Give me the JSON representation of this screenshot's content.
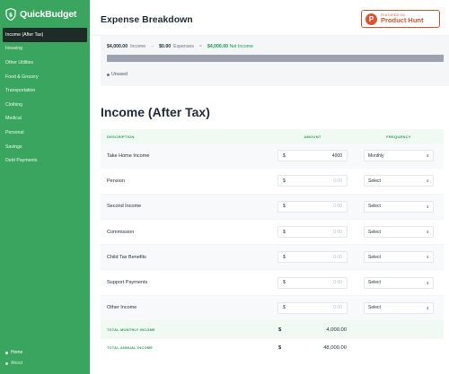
{
  "app": {
    "name": "QuickBudget"
  },
  "sidebar": {
    "items": [
      {
        "label": "Income (After Tax)",
        "active": true
      },
      {
        "label": "Housing"
      },
      {
        "label": "Other Utilities"
      },
      {
        "label": "Food & Grocery"
      },
      {
        "label": "Transportation"
      },
      {
        "label": "Clothing"
      },
      {
        "label": "Medical"
      },
      {
        "label": "Personal"
      },
      {
        "label": "Savings"
      },
      {
        "label": "Debt Payments"
      }
    ],
    "footer": [
      {
        "label": "Home"
      },
      {
        "label": "About"
      }
    ]
  },
  "header": {
    "title": "Expense Breakdown",
    "producthunt": {
      "small": "FEATURED ON",
      "big": "Product Hunt",
      "icon_letter": "P"
    }
  },
  "summary": {
    "income_value": "$4,000.00",
    "income_label": "Income",
    "op1": "−",
    "expenses_value": "$0.00",
    "expenses_label": "Expenses",
    "op2": "=",
    "net_value": "$4,000.00",
    "net_label": "Net Income",
    "legend_unused": "Unused",
    "bar_color": "#9ca3af"
  },
  "income": {
    "title": "Income (After Tax)",
    "columns": {
      "description": "DESCRIPTION",
      "amount": "AMOUNT",
      "frequency": "FREQUENCY"
    },
    "rows": [
      {
        "description": "Take Home Income",
        "currency": "$",
        "amount": "4000",
        "amount_placeholder": false,
        "frequency": "Monthly"
      },
      {
        "description": "Pension",
        "currency": "$",
        "amount": "0.00",
        "amount_placeholder": true,
        "frequency": "Select"
      },
      {
        "description": "Second Income",
        "currency": "$",
        "amount": "0.00",
        "amount_placeholder": true,
        "frequency": "Select"
      },
      {
        "description": "Commission",
        "currency": "$",
        "amount": "0.00",
        "amount_placeholder": true,
        "frequency": "Select"
      },
      {
        "description": "Child Tax Benefits",
        "currency": "$",
        "amount": "0.00",
        "amount_placeholder": true,
        "frequency": "Select"
      },
      {
        "description": "Support Payments",
        "currency": "$",
        "amount": "0.00",
        "amount_placeholder": true,
        "frequency": "Select"
      },
      {
        "description": "Other Income",
        "currency": "$",
        "amount": "0.00",
        "amount_placeholder": true,
        "frequency": "Select"
      }
    ],
    "totals": [
      {
        "label": "TOTAL MONTHLY INCOME",
        "currency": "$",
        "value": "4,000.00"
      },
      {
        "label": "TOTAL ANNUAL INCOME",
        "currency": "$",
        "value": "48,000.00"
      }
    ]
  },
  "colors": {
    "brand": "#3aa55e",
    "active_nav": "#1e2b27",
    "accent_text": "#2d9b57",
    "producthunt": "#da552f"
  }
}
